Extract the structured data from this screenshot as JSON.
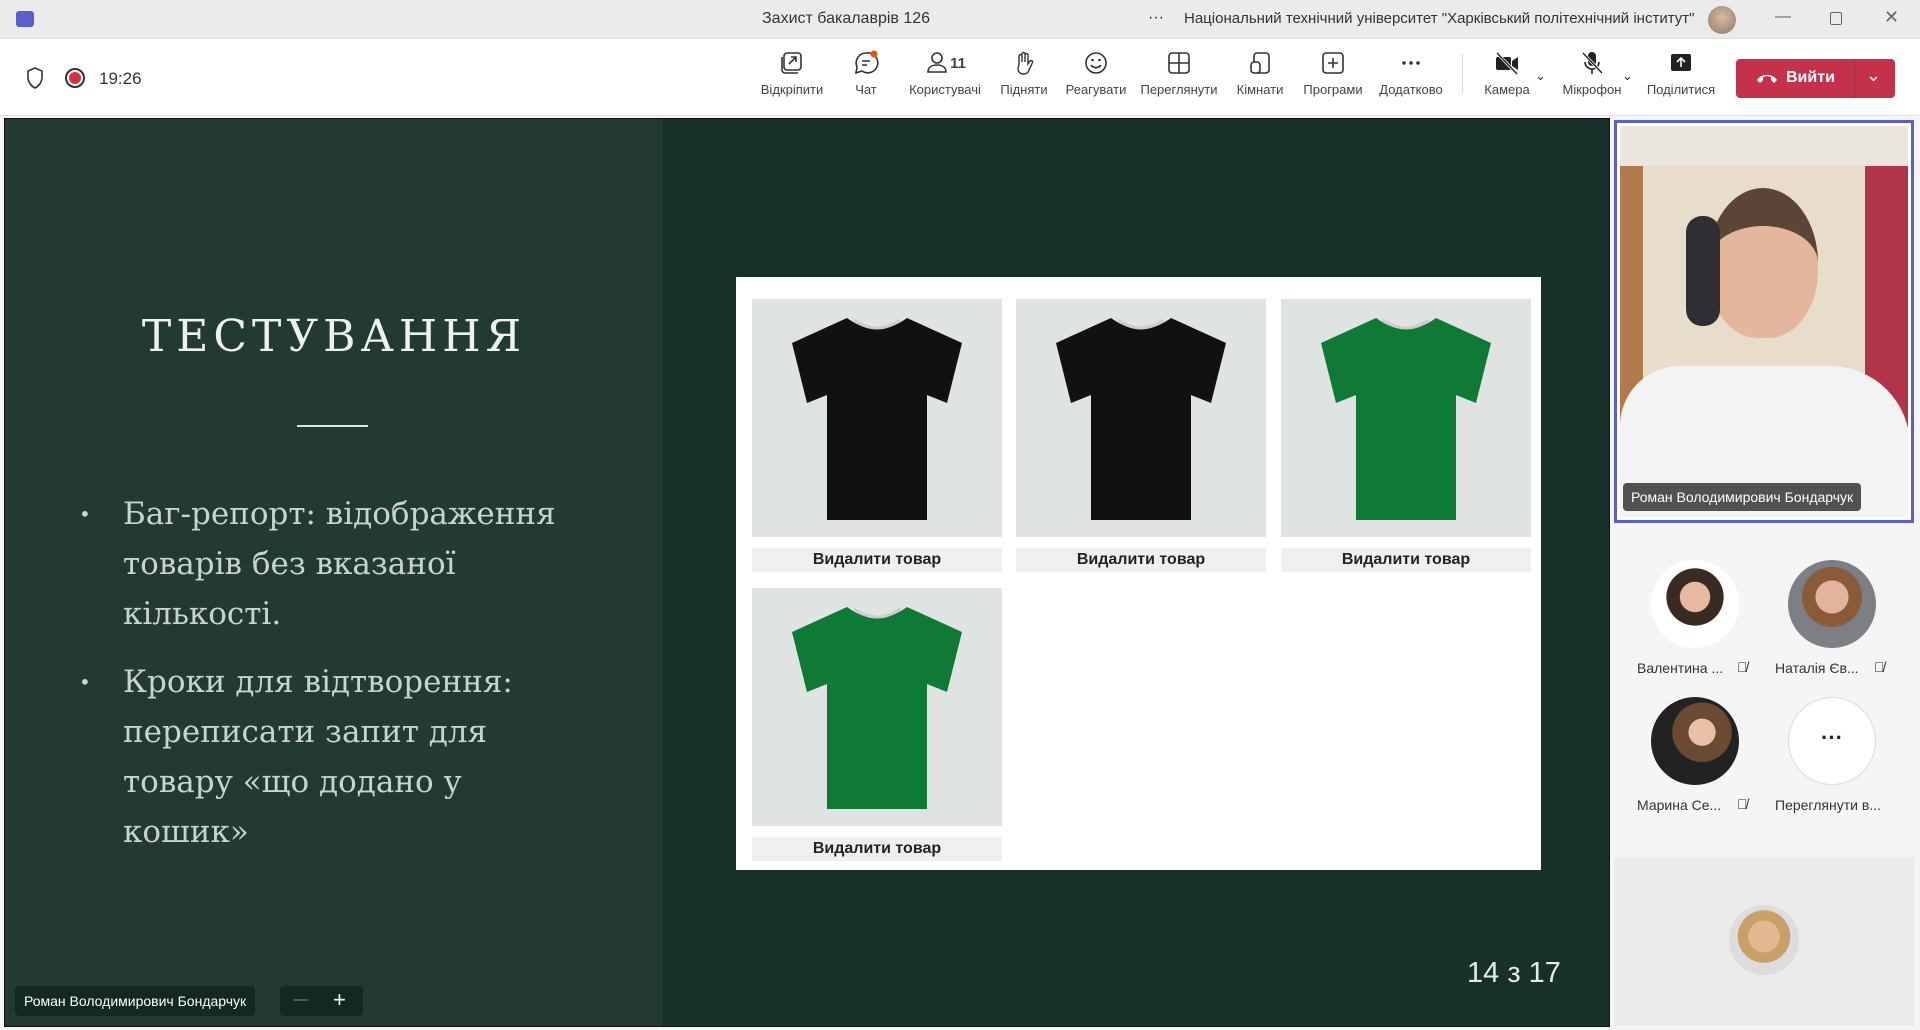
{
  "window": {
    "title": "Захист бакалаврів 126",
    "org": "Національний технічний університет \"Харківський політехнічний інститут\"",
    "more": "···"
  },
  "toolbar": {
    "timer": "19:26",
    "items": [
      {
        "label": "Відкріпити",
        "icon": "unpin-icon"
      },
      {
        "label": "Чат",
        "icon": "chat-icon"
      },
      {
        "label": "Користувачі",
        "icon": "people-icon",
        "count": "11"
      },
      {
        "label": "Підняти",
        "icon": "raise-hand-icon"
      },
      {
        "label": "Реагувати",
        "icon": "react-icon"
      },
      {
        "label": "Переглянути",
        "icon": "view-icon"
      },
      {
        "label": "Кімнати",
        "icon": "rooms-icon"
      },
      {
        "label": "Програми",
        "icon": "apps-icon"
      },
      {
        "label": "Додатково",
        "icon": "more-icon"
      },
      {
        "label": "Камера",
        "icon": "camera-off-icon"
      },
      {
        "label": "Мікрофон",
        "icon": "mic-off-icon"
      },
      {
        "label": "Поділитися",
        "icon": "share-icon"
      }
    ],
    "leave_label": "Вийти",
    "leave_color": "#c4314b"
  },
  "slide": {
    "title": "ТЕСТУВАННЯ",
    "bullets": [
      "Баг-репорт: відображення товарів без вказаної кількості.",
      "Кроки для відтворення: переписати запит для товару «що додано у кошик»"
    ],
    "products": [
      {
        "color": "#111111",
        "button": "Видалити товар"
      },
      {
        "color": "#111111",
        "button": "Видалити товар"
      },
      {
        "color": "#0f7a35",
        "button": "Видалити товар"
      },
      {
        "color": "#0f7a35",
        "button": "Видалити товар"
      }
    ],
    "page": "14 з 17"
  },
  "presenter": {
    "name": "Роман Володимирович Бондарчук",
    "zoom_out": "—",
    "zoom_in": "+"
  },
  "participants": [
    {
      "name": "Валентина ...",
      "muted": true
    },
    {
      "name": "Наталія Єв...",
      "muted": true
    },
    {
      "name": "Марина Се...",
      "muted": true
    },
    {
      "name": "Переглянути в...",
      "more": "···"
    }
  ]
}
